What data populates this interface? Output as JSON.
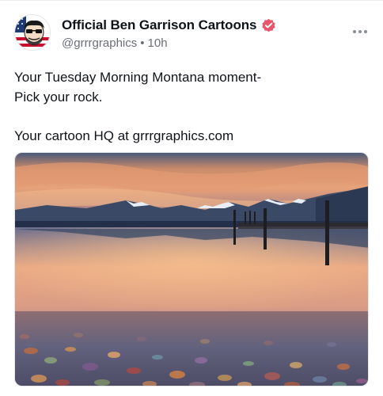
{
  "post": {
    "author": {
      "display_name": "Official  Ben Garrison Cartoons",
      "handle": "@grrrgraphics",
      "separator": "•",
      "time_ago": "10h",
      "verified": true,
      "verified_color": "#e8566b"
    },
    "text_lines": [
      "Your Tuesday Morning Montana moment-",
      "Pick your rock.",
      "",
      "Your cartoon HQ at grrrgraphics.com"
    ],
    "more_icon": "more-horizontal-icon",
    "media": {
      "type": "photo",
      "subject": "mountain-lake-colorful-rocks"
    }
  },
  "colors": {
    "text": "#0f1419",
    "muted": "#6b6f76",
    "badge": "#e8566b"
  }
}
